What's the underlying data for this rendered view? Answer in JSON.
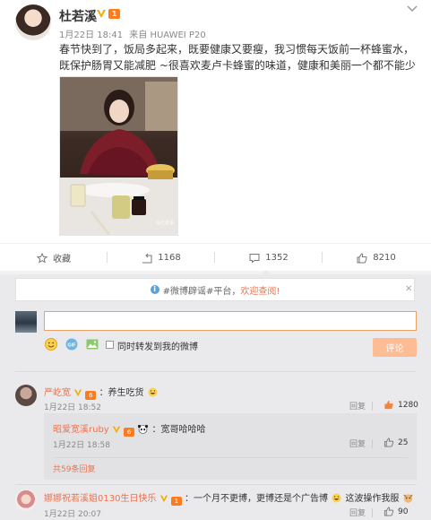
{
  "post": {
    "author": "杜若溪",
    "vip_level": "1",
    "date": "1月22日 18:41",
    "device": "来自 HUAWEI P20",
    "text_line1": "春节快到了，饭局多起来，既要健康又要瘦，我习惯每天饭前一杯蜂蜜水，既保",
    "text_line2": "护肠胃又能减肥 ~很喜欢麦卢卡蜂蜜的味道，健康和美丽一个都不能少",
    "photo_watermark": "@杜若溪"
  },
  "actions": {
    "favorite": "收藏",
    "repost": "1168",
    "comment": "1352",
    "like": "8210"
  },
  "composer": {
    "notice_prefix": "#微博辟谣#平台，",
    "notice_link": "欢迎查阅!",
    "close": "×",
    "checkbox_label": "同时转发到我的微博",
    "submit": "评论"
  },
  "comments": [
    {
      "user": "严屹宽",
      "vip_level": "6",
      "text": "：养生吃货",
      "time": "1月22日 18:52",
      "reply_label": "回复",
      "likes": "1280",
      "replies": [
        {
          "user": "昭爱宽溪ruby",
          "vip_level": "6",
          "text": "：宽哥哈哈哈",
          "time": "1月22日 18:58",
          "reply_label": "回复",
          "likes": "25"
        }
      ],
      "more": "共59条回复"
    },
    {
      "user": "娜娜祝若溪姐0130生日快乐",
      "vip_level": "1",
      "text_a": "：一个月不更博，更博还是个广告博",
      "text_b": "这波操作我服",
      "time": "1月22日 20:07",
      "reply_label": "回复",
      "likes": "90"
    }
  ],
  "colors": {
    "accent": "#eb7350",
    "vip": "#ff7a1a",
    "verified": "#f6ab00",
    "submit": "#fdbc93"
  }
}
